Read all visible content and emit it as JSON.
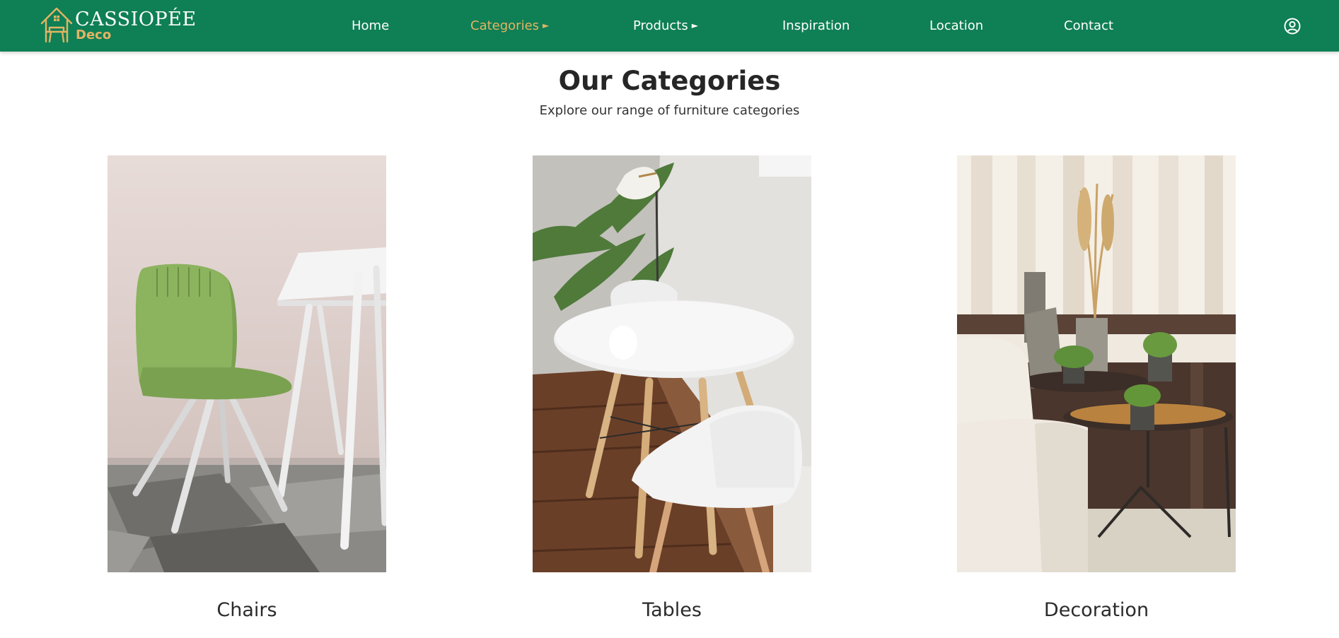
{
  "brand": {
    "name_top": "CASSIOPÉE",
    "name_bottom": "Deco",
    "icon": "house-chair-logo",
    "colors": {
      "primary": "#0f7f55",
      "accent": "#e3b463",
      "nav_text": "#ffffff"
    }
  },
  "nav": {
    "items": [
      {
        "label": "Home",
        "has_submenu": false,
        "active": false
      },
      {
        "label": "Categories",
        "has_submenu": true,
        "active": true
      },
      {
        "label": "Products",
        "has_submenu": true,
        "active": false
      },
      {
        "label": "Inspiration",
        "has_submenu": false,
        "active": false
      },
      {
        "label": "Location",
        "has_submenu": false,
        "active": false
      },
      {
        "label": "Contact",
        "has_submenu": false,
        "active": false
      }
    ],
    "submenu_arrow": "►",
    "account_icon": "user-circle-icon"
  },
  "main": {
    "title": "Our Categories",
    "subtitle": "Explore our range of furniture categories",
    "categories": [
      {
        "label": "Chairs"
      },
      {
        "label": "Tables"
      },
      {
        "label": "Decoration"
      }
    ]
  }
}
